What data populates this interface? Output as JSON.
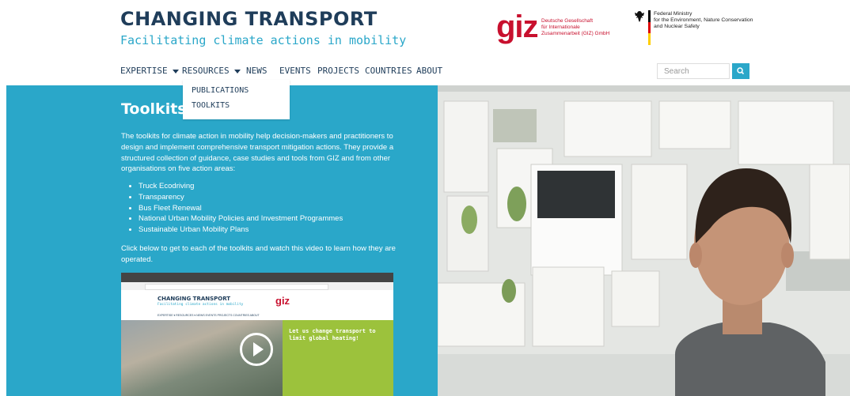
{
  "header": {
    "logo_title": "CHANGING TRANSPORT",
    "logo_subtitle": "Facilitating climate actions in mobility",
    "giz_word": "giz",
    "giz_lines": [
      "Deutsche Gesellschaft",
      "für Internationale",
      "Zusammenarbeit (GIZ) GmbH"
    ],
    "ministry_lines": [
      "Federal Ministry",
      "for the Environment, Nature Conservation",
      "and Nuclear Safety"
    ]
  },
  "nav": [
    {
      "label": "EXPERTISE",
      "has_caret": true
    },
    {
      "label": "RESOURCES",
      "has_caret": true
    },
    {
      "label": "NEWS",
      "has_caret": false
    },
    {
      "label": "EVENTS",
      "has_caret": false
    },
    {
      "label": "PROJECTS",
      "has_caret": false
    },
    {
      "label": "COUNTRIES",
      "has_caret": false
    },
    {
      "label": "ABOUT",
      "has_caret": false
    }
  ],
  "search": {
    "placeholder": "Search",
    "button_icon": "search-icon"
  },
  "dropdown": {
    "items": [
      "PUBLICATIONS",
      "TOOLKITS"
    ]
  },
  "main": {
    "title": "Toolkits",
    "intro": "The toolkits for climate action in mobility help decision-makers and practitioners to design and implement comprehensive transport mitigation actions. They provide a structured collection of guidance, case studies and tools from GIZ and from other organisations on five action areas:",
    "bullets": [
      "Truck Ecodriving",
      "Transparency",
      "Bus Fleet Renewal",
      "National Urban Mobility Policies and Investment Programmes",
      "Sustainable Urban Mobility Plans"
    ],
    "outro": "Click below to get to each of the toolkits and watch this video to learn how they are operated."
  },
  "video": {
    "title": "CHANGING TRANSPORT",
    "subtitle": "Facilitating climate actions in mobility",
    "giz": "giz",
    "nav": "EXPERTISE ▾  RESOURCES ▾  NEWS  EVENTS  PROJECTS  COUNTRIES  ABOUT",
    "headline": "Let us change transport to limit global heating!"
  },
  "colors": {
    "teal": "#2aa7c9",
    "navy": "#1f3d5a",
    "giz_red": "#c8102e",
    "video_green": "#9cc23c"
  }
}
